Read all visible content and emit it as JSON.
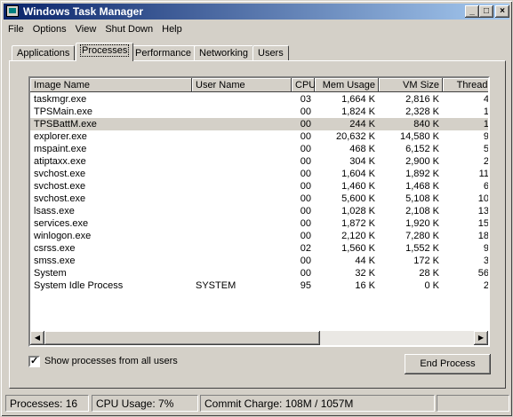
{
  "window": {
    "title": "Windows Task Manager"
  },
  "titlebar_buttons": {
    "minimize": "_",
    "maximize": "□",
    "close": "×"
  },
  "menu": [
    "File",
    "Options",
    "View",
    "Shut Down",
    "Help"
  ],
  "tabs": [
    "Applications",
    "Processes",
    "Performance",
    "Networking",
    "Users"
  ],
  "active_tab": "Processes",
  "columns": {
    "name": "Image Name",
    "user": "User Name",
    "cpu": "CPU",
    "mem": "Mem Usage",
    "vm": "VM Size",
    "threads": "Threads"
  },
  "processes": [
    {
      "name": "taskmgr.exe",
      "user": "",
      "cpu": "03",
      "mem": "1,664 K",
      "vm": "2,816 K",
      "threads": "4"
    },
    {
      "name": "TPSMain.exe",
      "user": "",
      "cpu": "00",
      "mem": "1,824 K",
      "vm": "2,328 K",
      "threads": "1"
    },
    {
      "name": "TPSBattM.exe",
      "user": "",
      "cpu": "00",
      "mem": "244 K",
      "vm": "840 K",
      "threads": "1",
      "selected": true
    },
    {
      "name": "explorer.exe",
      "user": "",
      "cpu": "00",
      "mem": "20,632 K",
      "vm": "14,580 K",
      "threads": "9"
    },
    {
      "name": "mspaint.exe",
      "user": "",
      "cpu": "00",
      "mem": "468 K",
      "vm": "6,152 K",
      "threads": "5"
    },
    {
      "name": "atiptaxx.exe",
      "user": "",
      "cpu": "00",
      "mem": "304 K",
      "vm": "2,900 K",
      "threads": "2"
    },
    {
      "name": "svchost.exe",
      "user": "",
      "cpu": "00",
      "mem": "1,604 K",
      "vm": "1,892 K",
      "threads": "11"
    },
    {
      "name": "svchost.exe",
      "user": "",
      "cpu": "00",
      "mem": "1,460 K",
      "vm": "1,468 K",
      "threads": "6"
    },
    {
      "name": "svchost.exe",
      "user": "",
      "cpu": "00",
      "mem": "5,600 K",
      "vm": "5,108 K",
      "threads": "10"
    },
    {
      "name": "lsass.exe",
      "user": "",
      "cpu": "00",
      "mem": "1,028 K",
      "vm": "2,108 K",
      "threads": "13"
    },
    {
      "name": "services.exe",
      "user": "",
      "cpu": "00",
      "mem": "1,872 K",
      "vm": "1,920 K",
      "threads": "15"
    },
    {
      "name": "winlogon.exe",
      "user": "",
      "cpu": "00",
      "mem": "2,120 K",
      "vm": "7,280 K",
      "threads": "18"
    },
    {
      "name": "csrss.exe",
      "user": "",
      "cpu": "02",
      "mem": "1,560 K",
      "vm": "1,552 K",
      "threads": "9"
    },
    {
      "name": "smss.exe",
      "user": "",
      "cpu": "00",
      "mem": "44 K",
      "vm": "172 K",
      "threads": "3"
    },
    {
      "name": "System",
      "user": "",
      "cpu": "00",
      "mem": "32 K",
      "vm": "28 K",
      "threads": "56"
    },
    {
      "name": "System Idle Process",
      "user": "SYSTEM",
      "cpu": "95",
      "mem": "16 K",
      "vm": "0 K",
      "threads": "2"
    }
  ],
  "show_all": {
    "label": "Show processes from all users",
    "checked": true,
    "mark": "✓"
  },
  "end_process_label": "End Process",
  "scroll_arrows": {
    "left": "◀",
    "right": "▶"
  },
  "status": {
    "processes": "Processes: 16",
    "cpu": "CPU Usage: 7%",
    "commit": "Commit Charge: 108M / 1057M"
  },
  "colors": {
    "title_start": "#0a246a",
    "title_end": "#a6caf0",
    "face": "#d4d0c8"
  }
}
